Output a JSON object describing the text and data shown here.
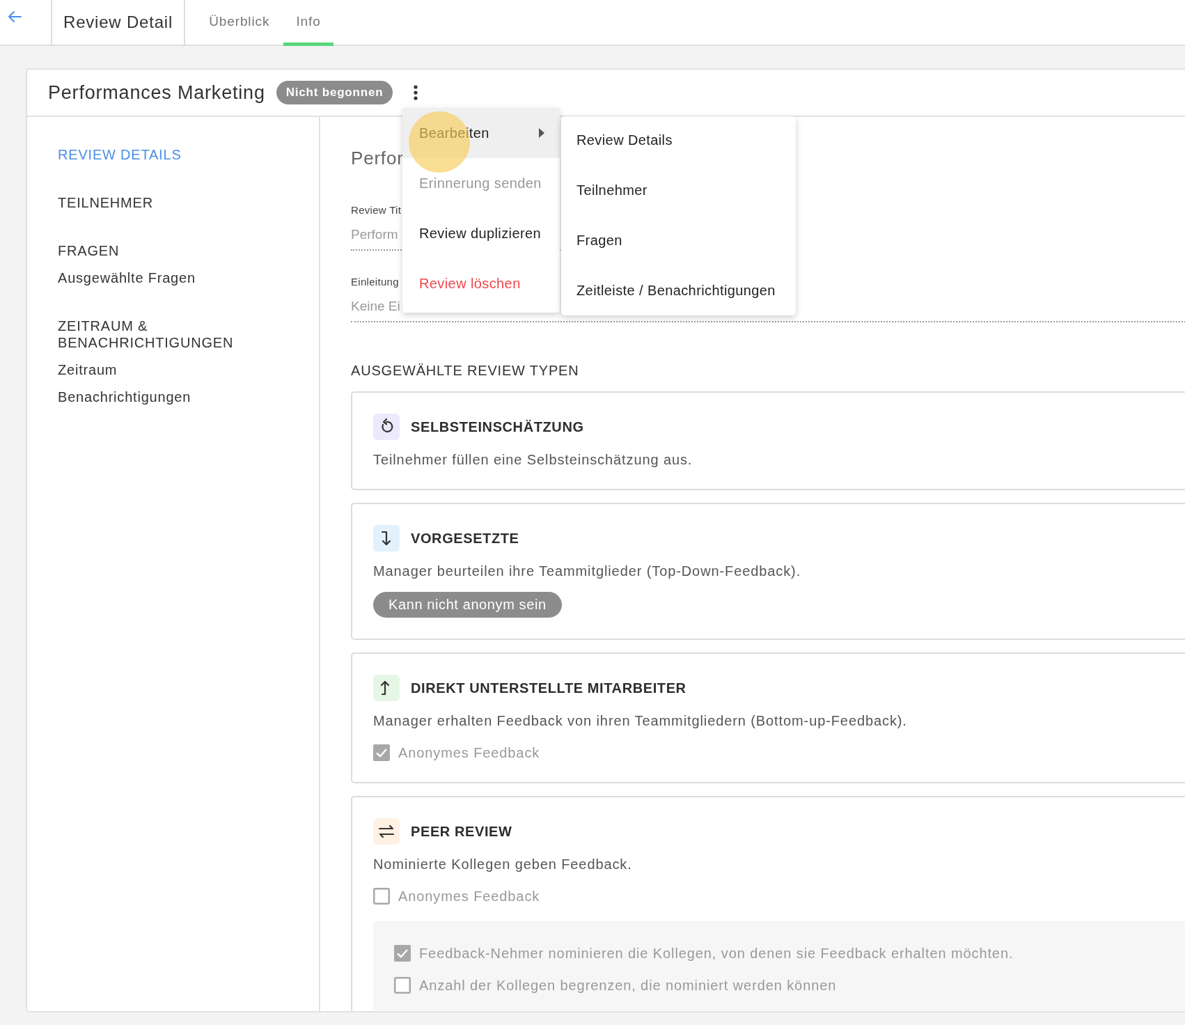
{
  "topbar": {
    "title": "Review Detail",
    "tabs": [
      {
        "label": "Überblick",
        "selected": false
      },
      {
        "label": "Info",
        "selected": true
      }
    ]
  },
  "review": {
    "title": "Performances Marketing",
    "status": "Nicht begonnen"
  },
  "sidebar": {
    "items": [
      {
        "label": "REVIEW DETAILS",
        "kind": "section",
        "selected": true
      },
      {
        "label": "TEILNEHMER",
        "kind": "section",
        "selected": false
      },
      {
        "label": "FRAGEN",
        "kind": "section",
        "selected": false
      },
      {
        "label": "Ausgewählte Fragen",
        "kind": "sub",
        "selected": false
      },
      {
        "label": "ZEITRAUM & BENACHRICHTIGUNGEN",
        "kind": "section",
        "selected": false
      },
      {
        "label": "Zeitraum",
        "kind": "sub",
        "selected": false
      },
      {
        "label": "Benachrichtigungen",
        "kind": "sub",
        "selected": false
      }
    ]
  },
  "details": {
    "heading": "Perfor",
    "fields": [
      {
        "label": "Review Tit",
        "value": "Perform",
        "kind": "short"
      },
      {
        "label": "Einleitung",
        "value": "Keine Ei",
        "kind": "full"
      }
    ]
  },
  "menu": {
    "items": [
      {
        "label": "Bearbeiten",
        "kind": "submenu",
        "selected": true,
        "disabled": false
      },
      {
        "label": "Erinnerung senden",
        "kind": "action",
        "selected": false,
        "disabled": true
      },
      {
        "label": "Review duplizieren",
        "kind": "action",
        "selected": false,
        "disabled": false
      },
      {
        "label": "Review löschen",
        "kind": "danger",
        "selected": false,
        "disabled": false
      }
    ],
    "submenu": [
      "Review Details",
      "Teilnehmer",
      "Fragen",
      "Zeitleiste / Benachrichtigungen"
    ]
  },
  "review_types": {
    "heading": "AUSGEWÄHLTE REVIEW TYPEN",
    "items": [
      {
        "kind": "self",
        "color": "#ebe9fb",
        "title": "SELBSTEINSCHÄTZUNG",
        "description": "Teilnehmer füllen eine Selbsteinschätzung aus."
      },
      {
        "kind": "down",
        "color": "#e3f1fc",
        "title": "VORGESETZTE",
        "description": "Manager beurteilen ihre Teammitglieder (Top-Down-Feedback).",
        "chip": "Kann nicht anonym sein"
      },
      {
        "kind": "up",
        "color": "#e6f6e6",
        "title": "DIREKT UNTERSTELLTE MITARBEITER",
        "description": "Manager erhalten Feedback von ihren Teammitgliedern (Bottom-up-Feedback).",
        "options": [
          {
            "label": "Anonymes Feedback",
            "checked": true
          }
        ]
      },
      {
        "kind": "peer",
        "color": "#fff1e3",
        "title": "PEER REVIEW",
        "description": "Nominierte Kollegen geben Feedback.",
        "options": [
          {
            "label": "Anonymes Feedback",
            "checked": false
          }
        ],
        "nested_options": [
          {
            "label": "Feedback-Nehmer nominieren die Kollegen, von denen sie Feedback erhalten möchten.",
            "checked": true
          },
          {
            "label": "Anzahl der Kollegen begrenzen, die nominiert werden können",
            "checked": false
          }
        ]
      }
    ]
  }
}
